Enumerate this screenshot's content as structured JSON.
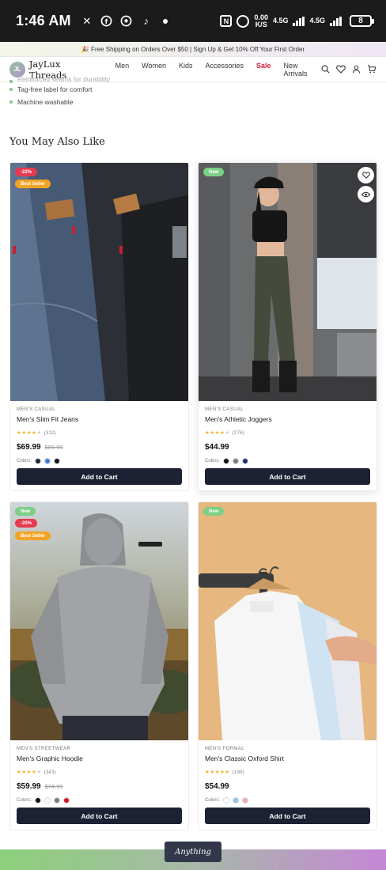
{
  "status_bar": {
    "time": "1:46 AM",
    "net_speed_value": "0.00",
    "net_speed_unit": "K/S",
    "network_1": "4.5G",
    "network_2": "4.5G",
    "battery": "8"
  },
  "promo": {
    "text": "🎉 Free Shipping on Orders Over $50 | Sign Up & Get 10% Off Your First Order"
  },
  "nav": {
    "logo_initials": "JL",
    "brand": "JayLux Threads",
    "links": [
      "Men",
      "Women",
      "Kids",
      "Accessories",
      "Sale",
      "New Arrivals"
    ]
  },
  "details": {
    "bullets": [
      "Reinforced seams for durability",
      "Tag-free label for comfort",
      "Machine washable"
    ]
  },
  "section_title": "You May Also Like",
  "products": [
    {
      "category": "MEN'S CASUAL",
      "name": "Men's Slim Fit Jeans",
      "rating": 4,
      "reviews": "(312)",
      "price": "$69.99",
      "old_price": "$89.99",
      "colors_label": "Colors:",
      "colors": [
        "#1f2638",
        "#3f7de8",
        "#111111"
      ],
      "badges": [
        "-22%",
        "Best Seller"
      ],
      "cta": "Add to Cart"
    },
    {
      "category": "MEN'S CASUAL",
      "name": "Men's Athletic Joggers",
      "rating": 4,
      "reviews": "(276)",
      "price": "$44.99",
      "old_price": "",
      "colors_label": "Colors:",
      "colors": [
        "#111111",
        "#7b7b7b",
        "#1d2d7a"
      ],
      "badges": [
        "New"
      ],
      "cta": "Add to Cart"
    },
    {
      "category": "MEN'S STREETWEAR",
      "name": "Men's Graphic Hoodie",
      "rating": 4,
      "reviews": "(343)",
      "price": "$59.99",
      "old_price": "$74.99",
      "colors_label": "Colors:",
      "colors": [
        "#111111",
        "#ffffff",
        "#7b7b7b",
        "#d4142a"
      ],
      "badges": [
        "New",
        "-20%",
        "Best Seller"
      ],
      "cta": "Add to Cart"
    },
    {
      "category": "MEN'S FORMAL",
      "name": "Men's Classic Oxford Shirt",
      "rating": 5,
      "reviews": "(198)",
      "price": "$54.99",
      "old_price": "",
      "colors_label": "Colors:",
      "colors": [
        "#ffffff",
        "#8ec7ee",
        "#f2a9bf"
      ],
      "badges": [
        "New"
      ],
      "cta": "Add to Cart"
    }
  ],
  "footer_pill": "Anything"
}
